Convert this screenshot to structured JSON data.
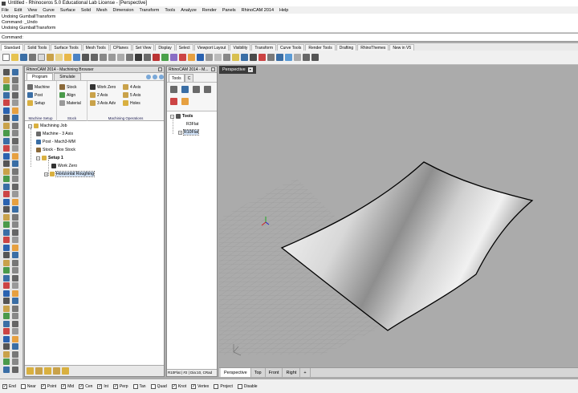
{
  "window": {
    "title": "Untitled - Rhinoceros 5.0 Educational Lab License - [Perspective]"
  },
  "menu": [
    "File",
    "Edit",
    "View",
    "Curve",
    "Surface",
    "Solid",
    "Mesh",
    "Dimension",
    "Transform",
    "Tools",
    "Analyze",
    "Render",
    "Panels",
    "RhinoCAM 2014",
    "Help"
  ],
  "command_history": [
    "Undoing GumballTransform",
    "Command: _Undo",
    "Undoing GumballTransform"
  ],
  "command_prompt": {
    "label": "Command:",
    "value": ""
  },
  "toolbar_tabs": [
    "Standard",
    "Solid Tools",
    "Surface Tools",
    "Mesh Tools",
    "CPlanes",
    "Set View",
    "Display",
    "Select",
    "Viewport Layout",
    "Visibility",
    "Transform",
    "Curve Tools",
    "Render Tools",
    "Drafting",
    "RhinoThemes",
    "New in V5"
  ],
  "browser": {
    "title": "RhinoCAM 2014 - Machining Browser",
    "tabs": [
      "Program",
      "Simulate"
    ],
    "machine_setup": {
      "buttons": [
        "Machine",
        "Post",
        "Setup"
      ],
      "label": "Machine Setup"
    },
    "stock": {
      "buttons": [
        "Stock",
        "Align",
        "Material"
      ],
      "label": "Stock"
    },
    "ops": {
      "buttons": [
        "Work Zero",
        "2 Axis",
        "3 Axis Adv",
        "4 Axis",
        "5 Axis",
        "Holes"
      ],
      "label": "Machining Operations"
    },
    "tree": {
      "job": "Machining Job",
      "machine": "Machine - 3 Axis",
      "post": "Post - Mach3-MM",
      "stock": "Stock - Box Stock",
      "setup": "Setup 1",
      "work_zero": "Work Zero",
      "op": "Horizontal Roughing"
    }
  },
  "tools_panel": {
    "title": "RhinoCAM 2014 - M...",
    "tab": "Tools",
    "tab2": "C",
    "tree": {
      "root": "Tools",
      "t1": "R3Flat",
      "t2": "R10Flat"
    },
    "status": "R10Flat | #2 | Dia:10, CRad"
  },
  "viewport": {
    "label": "Perspective"
  },
  "viewport_tabs": [
    "Perspective",
    "Top",
    "Front",
    "Right",
    "+"
  ],
  "osnaps": [
    {
      "name": "End",
      "on": true
    },
    {
      "name": "Near",
      "on": false
    },
    {
      "name": "Point",
      "on": true
    },
    {
      "name": "Mid",
      "on": true
    },
    {
      "name": "Cen",
      "on": true
    },
    {
      "name": "Int",
      "on": true
    },
    {
      "name": "Perp",
      "on": true
    },
    {
      "name": "Tan",
      "on": false
    },
    {
      "name": "Quad",
      "on": false
    },
    {
      "name": "Knot",
      "on": true
    },
    {
      "name": "Vertex",
      "on": true
    },
    {
      "name": "Project",
      "on": false
    },
    {
      "name": "Disable",
      "on": false
    }
  ],
  "colors": {
    "viewport_bg": "#ababab",
    "accent": "#3a6ea5"
  }
}
